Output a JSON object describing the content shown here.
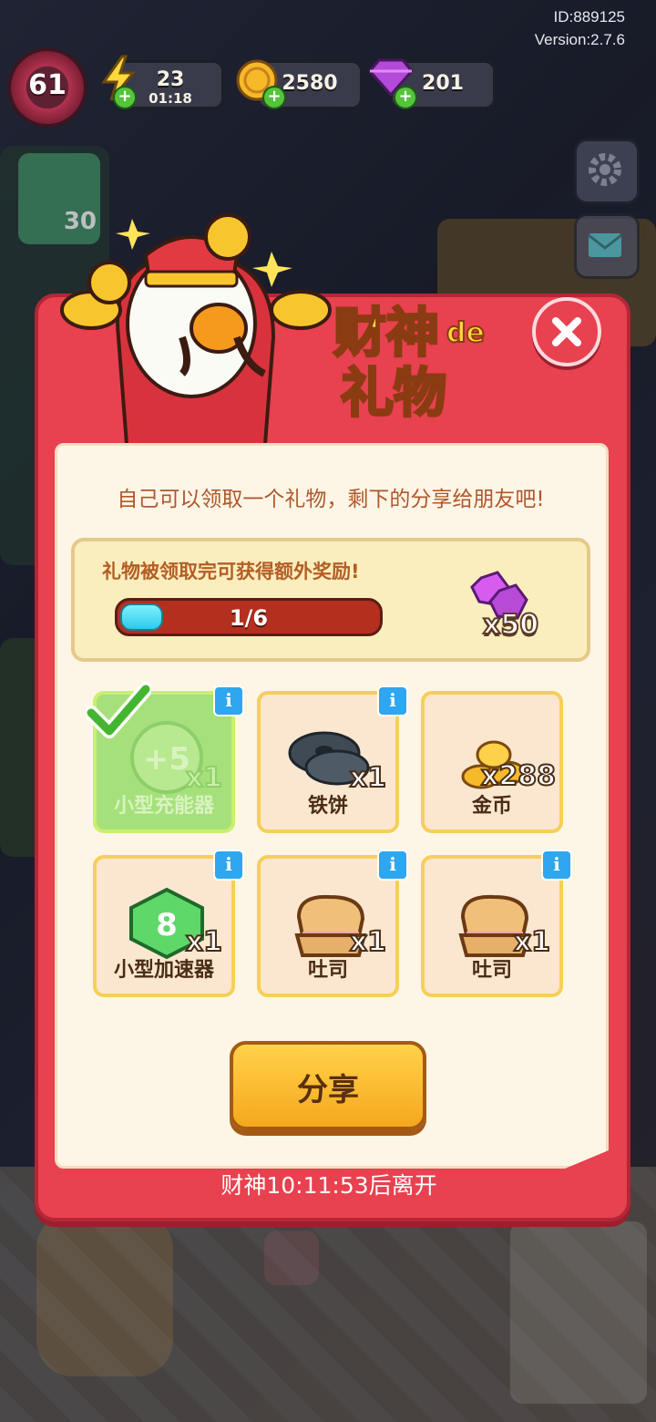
{
  "meta": {
    "id_text": "ID:889125",
    "version_text": "Version:2.7.6"
  },
  "hud": {
    "level": "61",
    "energy": "23",
    "energy_timer": "01:18",
    "coins": "2580",
    "gems": "201",
    "side_badge": "30"
  },
  "dialog": {
    "title_line1": "财神",
    "title_de": "de",
    "title_line2": "礼物",
    "intro": "自己可以领取一个礼物，剩下的分享给朋友吧!",
    "bonus_label": "礼物被领取完可获得额外奖励!",
    "progress_text": "1/6",
    "progress_fraction": 0.166,
    "bonus_reward_qty": "x50",
    "share_label": "分享",
    "footer": "财神10:11:53后离开"
  },
  "gifts": [
    {
      "name": "小型充能器",
      "qty": "x1",
      "claimed": true,
      "icon": "charger-icon"
    },
    {
      "name": "铁饼",
      "qty": "x1",
      "claimed": false,
      "icon": "discus-icon"
    },
    {
      "name": "金币",
      "qty": "x288",
      "claimed": false,
      "icon": "coins-icon"
    },
    {
      "name": "小型加速器",
      "qty": "x1",
      "claimed": false,
      "icon": "accelerator-icon"
    },
    {
      "name": "吐司",
      "qty": "x1",
      "claimed": false,
      "icon": "toast-icon"
    },
    {
      "name": "吐司",
      "qty": "x1",
      "claimed": false,
      "icon": "toast-icon"
    }
  ],
  "colors": {
    "dialog_red": "#e8414f",
    "paper": "#fdf6e6",
    "progress_cyan": "#2fc9ea",
    "share_yellow": "#ffd24a",
    "claimed_green": "#a6e07a"
  }
}
